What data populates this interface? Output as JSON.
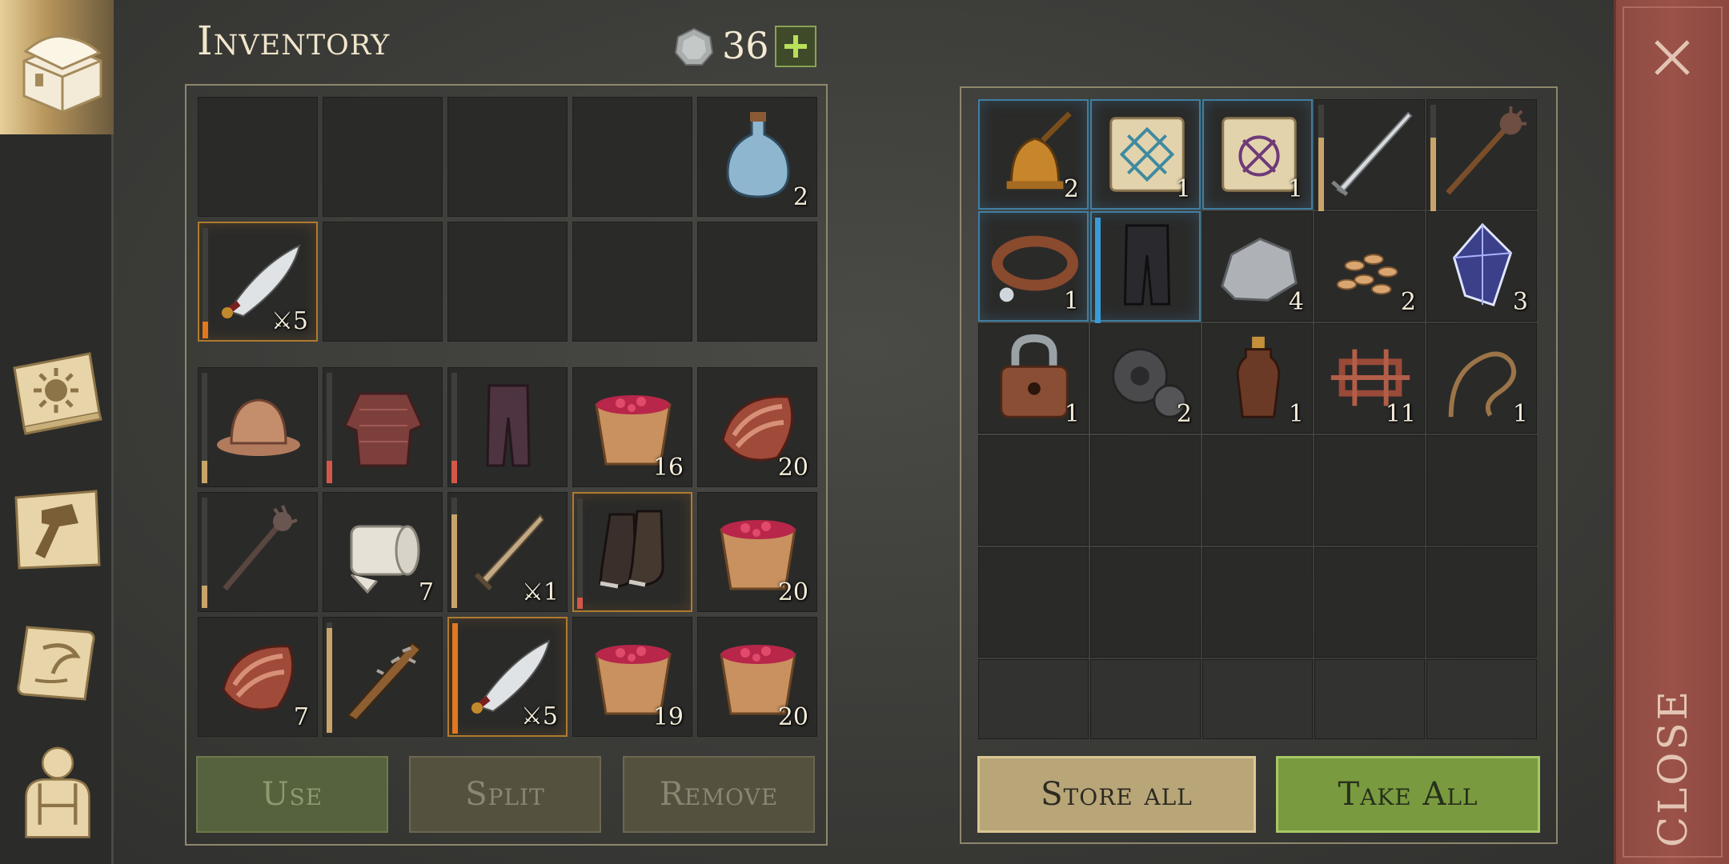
{
  "header": {
    "title": "Inventory",
    "coin_count": "36",
    "coin_icon": "silver-coin-icon",
    "add_icon": "plus-icon"
  },
  "sidebar": [
    {
      "name": "chest-icon",
      "active": true
    },
    {
      "name": "journal-icon",
      "active": false
    },
    {
      "name": "crafting-icon",
      "active": false
    },
    {
      "name": "quests-scroll-icon",
      "active": false
    },
    {
      "name": "character-icon",
      "active": false
    }
  ],
  "inventory": {
    "quick": [
      {
        "item": null,
        "count": ""
      },
      {
        "item": null,
        "count": ""
      },
      {
        "item": null,
        "count": ""
      },
      {
        "item": null,
        "count": ""
      },
      {
        "item": "water-flask",
        "count": "2"
      },
      {
        "item": "scimitar",
        "count": "5",
        "weapon_badge": true,
        "durability": 0.15,
        "bar_color": "#e3781e",
        "hl": "gold"
      },
      {
        "item": null,
        "count": ""
      },
      {
        "item": null,
        "count": ""
      },
      {
        "item": null,
        "count": ""
      },
      {
        "item": null,
        "count": ""
      }
    ],
    "bag": [
      {
        "item": "iron-helmet",
        "count": "",
        "durability": 0.2,
        "bar_color": "#c9a46a"
      },
      {
        "item": "chainmail",
        "count": "",
        "durability": 0.2,
        "bar_color": "#d4584a"
      },
      {
        "item": "leather-pants",
        "count": "",
        "durability": 0.2,
        "bar_color": "#d4584a"
      },
      {
        "item": "berry-bowl",
        "count": "16"
      },
      {
        "item": "raw-meat",
        "count": "20"
      },
      {
        "item": "spiked-mace",
        "count": "",
        "durability": 0.2,
        "bar_color": "#c9a46a"
      },
      {
        "item": "bandage-roll",
        "count": "7"
      },
      {
        "item": "short-sword",
        "count": "1",
        "weapon_badge": true,
        "durability": 0.85,
        "bar_color": "#c9a46a"
      },
      {
        "item": "leather-boots",
        "count": "",
        "durability": 0.1,
        "bar_color": "#d4584a",
        "hl": "gold"
      },
      {
        "item": "berry-bowl",
        "count": "20"
      },
      {
        "item": "raw-meat",
        "count": "7"
      },
      {
        "item": "spiked-club",
        "count": "",
        "durability": 0.95,
        "bar_color": "#c9a46a"
      },
      {
        "item": "scimitar",
        "count": "5",
        "weapon_badge": true,
        "durability": 1,
        "bar_color": "#e3781e",
        "hl": "gold"
      },
      {
        "item": "berry-bowl",
        "count": "19"
      },
      {
        "item": "berry-bowl",
        "count": "20"
      }
    ]
  },
  "storage": {
    "slots": [
      {
        "item": "bronze-bell",
        "count": "2",
        "hl": "blue"
      },
      {
        "item": "scroll-blue",
        "count": "1",
        "hl": "blue"
      },
      {
        "item": "scroll-purple",
        "count": "1",
        "hl": "blue"
      },
      {
        "item": "long-sword",
        "count": "",
        "durability": 0.7,
        "bar_color": "#c9a46a"
      },
      {
        "item": "morning-star",
        "count": "",
        "durability": 0.7,
        "bar_color": "#c9a46a"
      },
      {
        "item": "dog-collar",
        "count": "1",
        "hl": "blue"
      },
      {
        "item": "dark-leggings",
        "count": "",
        "hl": "blue",
        "durability": 1,
        "bar_color": "#3a9bd6"
      },
      {
        "item": "stone",
        "count": "4"
      },
      {
        "item": "seeds",
        "count": "2"
      },
      {
        "item": "crystal",
        "count": "3"
      },
      {
        "item": "padlock",
        "count": "1"
      },
      {
        "item": "gear",
        "count": "2"
      },
      {
        "item": "bottle",
        "count": "1"
      },
      {
        "item": "scrap-metal",
        "count": "11"
      },
      {
        "item": "rope",
        "count": "1"
      },
      {
        "item": null,
        "count": ""
      },
      {
        "item": null,
        "count": ""
      },
      {
        "item": null,
        "count": ""
      },
      {
        "item": null,
        "count": ""
      },
      {
        "item": null,
        "count": ""
      },
      {
        "item": null,
        "count": ""
      },
      {
        "item": null,
        "count": ""
      },
      {
        "item": null,
        "count": ""
      },
      {
        "item": null,
        "count": ""
      },
      {
        "item": null,
        "count": ""
      },
      {
        "item": null,
        "count": "",
        "dim": true
      },
      {
        "item": null,
        "count": "",
        "dim": true
      },
      {
        "item": null,
        "count": "",
        "dim": true
      },
      {
        "item": null,
        "count": "",
        "dim": true
      },
      {
        "item": null,
        "count": "",
        "dim": true
      }
    ]
  },
  "buttons": {
    "use": "Use",
    "split": "Split",
    "remove": "Remove",
    "store_all": "Store all",
    "take_all": "Take All"
  },
  "close": {
    "label": "CLOSE",
    "icon": "close-x-icon"
  },
  "colors": {
    "accent_green": "#7a9a40",
    "gold": "#b8a679",
    "close_rail": "#9b5248",
    "rarity_blue": "#3f7fa3"
  }
}
